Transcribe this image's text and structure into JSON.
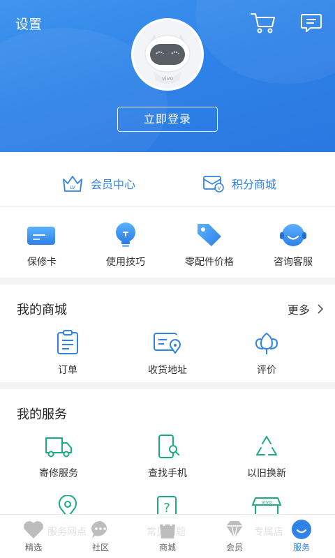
{
  "header": {
    "settings_label": "设置",
    "login_label": "立即登录",
    "avatar_brand": "vivo"
  },
  "member": {
    "center_label": "会员中心",
    "center_badge": "LV",
    "points_label": "积分商城",
    "points_badge": "V"
  },
  "quick": {
    "items": [
      {
        "label": "保修卡"
      },
      {
        "label": "使用技巧"
      },
      {
        "label": "零配件价格"
      },
      {
        "label": "咨询客服"
      }
    ]
  },
  "mall": {
    "title": "我的商城",
    "more_label": "更多",
    "items": [
      {
        "label": "订单"
      },
      {
        "label": "收货地址"
      },
      {
        "label": "评价"
      }
    ]
  },
  "services": {
    "title": "我的服务",
    "items": [
      {
        "label": "寄修服务"
      },
      {
        "label": "查找手机"
      },
      {
        "label": "以旧换新"
      }
    ],
    "partial": {
      "label_1": "服务网点",
      "label_2": "常见问题",
      "vivo_badge": "vivo",
      "label_3": "专属店"
    }
  },
  "nav": {
    "items": [
      {
        "label": "精选"
      },
      {
        "label": "社区"
      },
      {
        "label": "商城"
      },
      {
        "label": "会员"
      },
      {
        "label": "服务"
      }
    ],
    "active_index": 4
  },
  "colors": {
    "brand_blue": "#2f83e8",
    "service_green": "#1aab7f"
  }
}
